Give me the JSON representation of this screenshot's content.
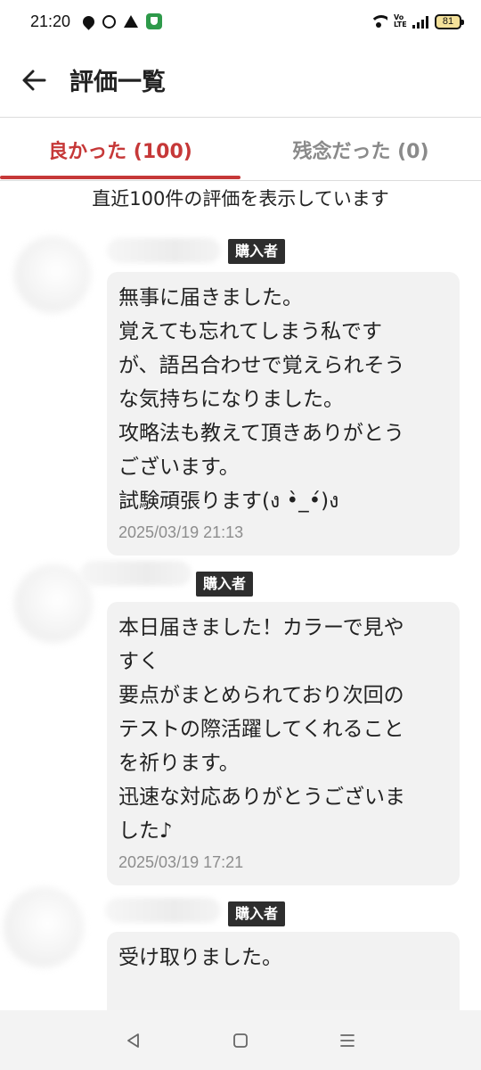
{
  "status_bar": {
    "time": "21:20",
    "volte": "Vo LTE",
    "battery": "81"
  },
  "header": {
    "title": "評価一覧"
  },
  "tabs": {
    "good": "良かった (100)",
    "bad": "残念だった (0)"
  },
  "notice": "直近100件の評価を表示しています",
  "reviews": [
    {
      "badge": "購入者",
      "text": "無事に届きました。\n覚えても忘れてしまう私です\nが、語呂合わせで覚えられそう\nな気持ちになりました。\n攻略法も教えて頂きありがとう\nございます。\n試験頑張ります(ง •̀_•́)ง",
      "date": "2025/03/19 21:13"
    },
    {
      "badge": "購入者",
      "text": "本日届きました！カラーで見や\nすく\n要点がまとめられており次回の\nテストの際活躍してくれること\nを祈ります。\n迅速な対応ありがとうございま\nした♪",
      "date": "2025/03/19 17:21"
    },
    {
      "badge": "購入者",
      "text": "受け取りました。",
      "date": ""
    }
  ],
  "colors": {
    "accent": "#c63838",
    "badge_bg": "#2e2e2e",
    "bubble_bg": "#f2f2f2"
  },
  "icons": {
    "back": "arrow-left-icon",
    "nav_back": "triangle-back-icon",
    "nav_home": "square-home-icon",
    "nav_menu": "menu-lines-icon"
  }
}
